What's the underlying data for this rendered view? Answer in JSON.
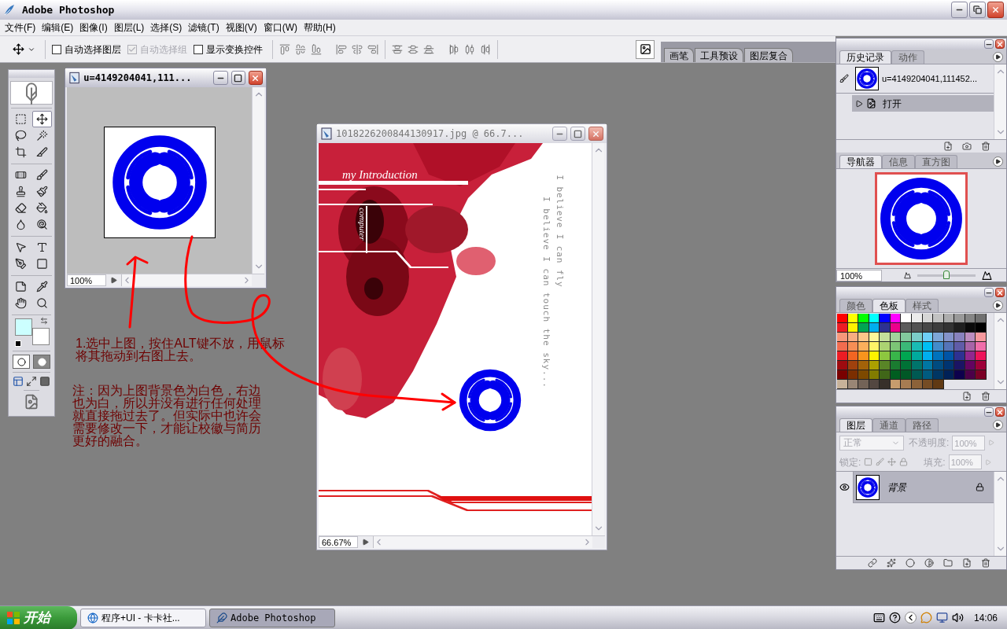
{
  "window": {
    "title": "Adobe Photoshop"
  },
  "menu": [
    {
      "label": "文件(F)"
    },
    {
      "label": "编辑(E)"
    },
    {
      "label": "图像(I)"
    },
    {
      "label": "图层(L)"
    },
    {
      "label": "选择(S)"
    },
    {
      "label": "滤镜(T)"
    },
    {
      "label": "视图(V)"
    },
    {
      "label": "窗口(W)"
    },
    {
      "label": "帮助(H)"
    }
  ],
  "options_bar": {
    "checkboxes": [
      {
        "label": "自动选择图层",
        "checked": false,
        "disabled": false
      },
      {
        "label": "自动选择组",
        "checked": true,
        "disabled": true
      },
      {
        "label": "显示变换控件",
        "checked": false,
        "disabled": false
      }
    ]
  },
  "palette_well": {
    "tabs": [
      {
        "label": "画笔"
      },
      {
        "label": "工具预设"
      },
      {
        "label": "图层复合"
      }
    ]
  },
  "toolbox": {
    "tools": [
      {
        "kind": "marquee",
        "selected": false
      },
      {
        "kind": "move",
        "selected": true
      },
      {
        "kind": "lasso",
        "selected": false
      },
      {
        "kind": "wand",
        "selected": false
      },
      {
        "kind": "crop",
        "selected": false
      },
      {
        "kind": "slice",
        "selected": false
      },
      {
        "kind": "heal",
        "selected": false
      },
      {
        "kind": "brush",
        "selected": false
      },
      {
        "kind": "stamp",
        "selected": false
      },
      {
        "kind": "history_brush",
        "selected": false
      },
      {
        "kind": "eraser",
        "selected": false
      },
      {
        "kind": "bucket",
        "selected": false
      },
      {
        "kind": "blur",
        "selected": false
      },
      {
        "kind": "dodge",
        "selected": false
      },
      {
        "kind": "path_select",
        "selected": false
      },
      {
        "kind": "type",
        "selected": false
      },
      {
        "kind": "pen",
        "selected": false
      },
      {
        "kind": "shape",
        "selected": false
      },
      {
        "kind": "notes",
        "selected": false
      },
      {
        "kind": "eyedropper",
        "selected": false
      },
      {
        "kind": "hand",
        "selected": false
      },
      {
        "kind": "zoom",
        "selected": false
      }
    ],
    "colors": [
      {
        "kind": "foreground",
        "color": "#ccffff"
      },
      {
        "kind": "background",
        "color": "#ffffff"
      }
    ]
  },
  "documents": [
    {
      "title": "u=4149204041,111...",
      "active": true,
      "zoom": "100%"
    },
    {
      "title": "1018226200844130917.jpg @ 66.7...",
      "active": false,
      "zoom": "66.67%",
      "canvas_texts": [
        {
          "kind": "heading",
          "text": "my Introduction"
        },
        {
          "kind": "tag",
          "text": "computer"
        },
        {
          "kind": "line1",
          "text": "I believe I can fly"
        },
        {
          "kind": "line2",
          "text": "I believe I can touch the sky..."
        }
      ]
    }
  ],
  "annotations": [
    {
      "text": "1.选中上图，按住ALT键不放，用鼠标将其拖动到右图上去。"
    },
    {
      "text": "注：因为上图背景色为白色，右边也为白，所以并没有进行任何处理就直接拖过去了。但实际中也许会需要修改一下，才能让校徽与简历更好的融合。"
    }
  ],
  "history": {
    "tabs": [
      {
        "label": "历史记录",
        "selected": true
      },
      {
        "label": "动作",
        "selected": false
      }
    ],
    "snapshot": "u=4149204041,111452...",
    "states": [
      {
        "label": "打开",
        "selected": true
      }
    ]
  },
  "navigator": {
    "tabs": [
      {
        "label": "导航器",
        "selected": true
      },
      {
        "label": "信息",
        "selected": false
      },
      {
        "label": "直方图",
        "selected": false
      }
    ],
    "zoom": "100%",
    "level": 0.5
  },
  "swatches": {
    "tabs": [
      {
        "label": "颜色",
        "selected": false
      },
      {
        "label": "色板",
        "selected": true
      },
      {
        "label": "样式",
        "selected": false
      }
    ],
    "colors": [
      {
        "color": "#ff0000"
      },
      {
        "color": "#ffff00"
      },
      {
        "color": "#00ff00"
      },
      {
        "color": "#00ffff"
      },
      {
        "color": "#0000ff"
      },
      {
        "color": "#ff00ff"
      },
      {
        "color": "#ffffff"
      },
      {
        "color": "#ebebeb"
      },
      {
        "color": "#d6d6d6"
      },
      {
        "color": "#c2c2c2"
      },
      {
        "color": "#adadad"
      },
      {
        "color": "#999999"
      },
      {
        "color": "#858585"
      },
      {
        "color": "#707070"
      },
      {
        "color": "#ed1c24"
      },
      {
        "color": "#fff200"
      },
      {
        "color": "#00a651"
      },
      {
        "color": "#00aeef"
      },
      {
        "color": "#2e3192"
      },
      {
        "color": "#ec008c"
      },
      {
        "color": "#5c5c5c"
      },
      {
        "color": "#525252"
      },
      {
        "color": "#474747"
      },
      {
        "color": "#3d3d3d"
      },
      {
        "color": "#333333"
      },
      {
        "color": "#1f1f1f"
      },
      {
        "color": "#0a0a0a"
      },
      {
        "color": "#000000"
      },
      {
        "color": "#f7977a"
      },
      {
        "color": "#f9ad81"
      },
      {
        "color": "#fdc68a"
      },
      {
        "color": "#fff79a"
      },
      {
        "color": "#c4df9b"
      },
      {
        "color": "#a3d39c"
      },
      {
        "color": "#82ca9d"
      },
      {
        "color": "#7bcdc8"
      },
      {
        "color": "#6ecff6"
      },
      {
        "color": "#7ea7d8"
      },
      {
        "color": "#8493ca"
      },
      {
        "color": "#8882be"
      },
      {
        "color": "#bc8dbf"
      },
      {
        "color": "#f6989d"
      },
      {
        "color": "#f26c4f"
      },
      {
        "color": "#f68e55"
      },
      {
        "color": "#fbaf5c"
      },
      {
        "color": "#fff467"
      },
      {
        "color": "#acd372"
      },
      {
        "color": "#7cc576"
      },
      {
        "color": "#3bb878"
      },
      {
        "color": "#1abbb4"
      },
      {
        "color": "#00bff3"
      },
      {
        "color": "#438cca"
      },
      {
        "color": "#5574b9"
      },
      {
        "color": "#605ca8"
      },
      {
        "color": "#a864a8"
      },
      {
        "color": "#f06eaa"
      },
      {
        "color": "#ed1c24"
      },
      {
        "color": "#f26522"
      },
      {
        "color": "#f7941d"
      },
      {
        "color": "#fff200"
      },
      {
        "color": "#8dc73f"
      },
      {
        "color": "#39b54a"
      },
      {
        "color": "#00a651"
      },
      {
        "color": "#00a99d"
      },
      {
        "color": "#00aeef"
      },
      {
        "color": "#0072bc"
      },
      {
        "color": "#0054a6"
      },
      {
        "color": "#2e3192"
      },
      {
        "color": "#92278f"
      },
      {
        "color": "#ed145b"
      },
      {
        "color": "#9e0b0f"
      },
      {
        "color": "#a0410d"
      },
      {
        "color": "#a36209"
      },
      {
        "color": "#aba000"
      },
      {
        "color": "#598527"
      },
      {
        "color": "#1a7b30"
      },
      {
        "color": "#007236"
      },
      {
        "color": "#00746b"
      },
      {
        "color": "#0076a3"
      },
      {
        "color": "#004b80"
      },
      {
        "color": "#003471"
      },
      {
        "color": "#1b1464"
      },
      {
        "color": "#630460"
      },
      {
        "color": "#9e0039"
      },
      {
        "color": "#790000"
      },
      {
        "color": "#7b2e00"
      },
      {
        "color": "#7d4900"
      },
      {
        "color": "#827b00"
      },
      {
        "color": "#406618"
      },
      {
        "color": "#005e20"
      },
      {
        "color": "#005826"
      },
      {
        "color": "#005952"
      },
      {
        "color": "#005b7f"
      },
      {
        "color": "#003663"
      },
      {
        "color": "#002157"
      },
      {
        "color": "#0d004c"
      },
      {
        "color": "#4b0049"
      },
      {
        "color": "#7a0026"
      },
      {
        "color": "#c7b299"
      },
      {
        "color": "#998675"
      },
      {
        "color": "#736357"
      },
      {
        "color": "#534741"
      },
      {
        "color": "#37302a"
      },
      {
        "color": "#c69c6d"
      },
      {
        "color": "#a67c52"
      },
      {
        "color": "#8c6239"
      },
      {
        "color": "#754c24"
      },
      {
        "color": "#603913"
      }
    ]
  },
  "layers": {
    "tabs": [
      {
        "label": "图层",
        "selected": true
      },
      {
        "label": "通道",
        "selected": false
      },
      {
        "label": "路径",
        "selected": false
      }
    ],
    "blend_mode": "正常",
    "opacity_label": "不透明度:",
    "opacity": "100%",
    "lock_label": "锁定:",
    "fill_label": "填充:",
    "fill": "100%",
    "options_disabled": true,
    "items": [
      {
        "name": "背景",
        "visible": true,
        "selected": true,
        "locked": true
      }
    ]
  },
  "taskbar": {
    "start": "开始",
    "tasks": [
      {
        "label": "程序+UI - 卡卡社...",
        "selected": false
      },
      {
        "label": "Adobe Photoshop",
        "selected": true
      }
    ],
    "clock": "14:06"
  }
}
